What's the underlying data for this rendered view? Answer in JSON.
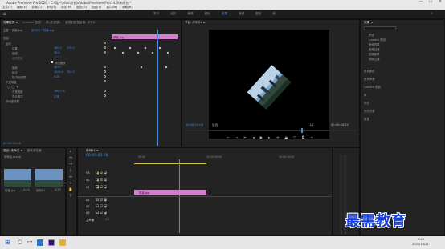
{
  "window": {
    "title": "Adobe Premiere Pro 2020 - C:\\用户\\yfan\\文档\\Adobe\\Premiere Pro\\14.0\\未命名 *",
    "controls": [
      "—",
      "☐",
      "✕"
    ]
  },
  "menu": [
    "文件(F)",
    "编辑(E)",
    "剪辑(C)",
    "序列(S)",
    "标记(M)",
    "图形(G)",
    "视图(V)",
    "窗口(W)",
    "帮助(H)"
  ],
  "workspaces": {
    "items": [
      "学习",
      "组件",
      "编辑",
      "颜色",
      "效果",
      "音频",
      "图形",
      "库"
    ],
    "active_index": 4
  },
  "effect_controls": {
    "tabs": [
      "效果控件 ≡",
      "Lumetri 范围",
      "源:(无剪辑)",
      "音频剪辑混合器: 序列01"
    ],
    "source": "主要 * 风景.jpg",
    "clip": "序列01 * 风景.jpg",
    "mini_timeline_clip": "风景.jpg",
    "sections": {
      "video": "视频",
      "motion": "运动",
      "position": "位置",
      "scale": "缩放",
      "scale_width": "缩放宽度",
      "uniform_scale": "等比缩放",
      "rotation": "旋转",
      "anchor": "锚点",
      "anti_flicker": "防闪烁滤镜",
      "opacity": "不透明度",
      "opacity_value": "不透明度",
      "blend_mode": "混合模式",
      "time_remap": "时间重映射"
    },
    "values": {
      "position_x": "180.0",
      "position_y": "270.0",
      "scale": "38.0",
      "scale_width": "100.0",
      "rotation": "48.0°",
      "anchor_x": "1000.0",
      "anchor_y": "750.0",
      "anti_flicker": "0.00",
      "opacity": "100.0 %",
      "blend_mode": "正常"
    },
    "timecode": "00:00:03:08"
  },
  "program": {
    "title": "节目: 序列01 ≡",
    "timecode_left": "00:00:03:08",
    "fit": "适合",
    "ratio": "1/2",
    "timecode_right": "00:00:04:24",
    "playhead_position": 0.68
  },
  "right_panel": {
    "title": "效果 ≡",
    "tree": [
      "预设",
      "Lumetri 预设",
      "音频效果",
      "音频过渡",
      "视频效果",
      "视频过渡"
    ],
    "sections": [
      "基本图形",
      "基本声音",
      "Lumetri 颜色",
      "库",
      "标记",
      "历史记录",
      "信息"
    ]
  },
  "project": {
    "tabs": [
      "项目: 未命名 ≡",
      "媒体浏览器"
    ],
    "name": "未命名.prproj",
    "items": [
      {
        "label": "风景.jpg",
        "time": "4:29"
      },
      {
        "label": "序列01",
        "time": "4:29"
      }
    ]
  },
  "timeline": {
    "title": "序列01 ≡",
    "timecode": "00:00:03:08",
    "ruler": [
      "00:00",
      "00:00:05:00",
      "00:00:10:00"
    ],
    "video_tracks": [
      "V3",
      "V2",
      "V1"
    ],
    "audio_tracks": [
      "A1",
      "A2",
      "A3"
    ],
    "master": "主声道",
    "master_value": "0.0",
    "clip_label": "风景.jpg",
    "playhead_position": 0.29
  },
  "taskbar": {
    "time": "9:28",
    "date": "2021/10/22"
  },
  "watermark": "最需教育",
  "colors": {
    "accent": "#4b8bd9",
    "clip": "#d87cd0",
    "panel": "#232323",
    "background": "#1d1d1d"
  }
}
